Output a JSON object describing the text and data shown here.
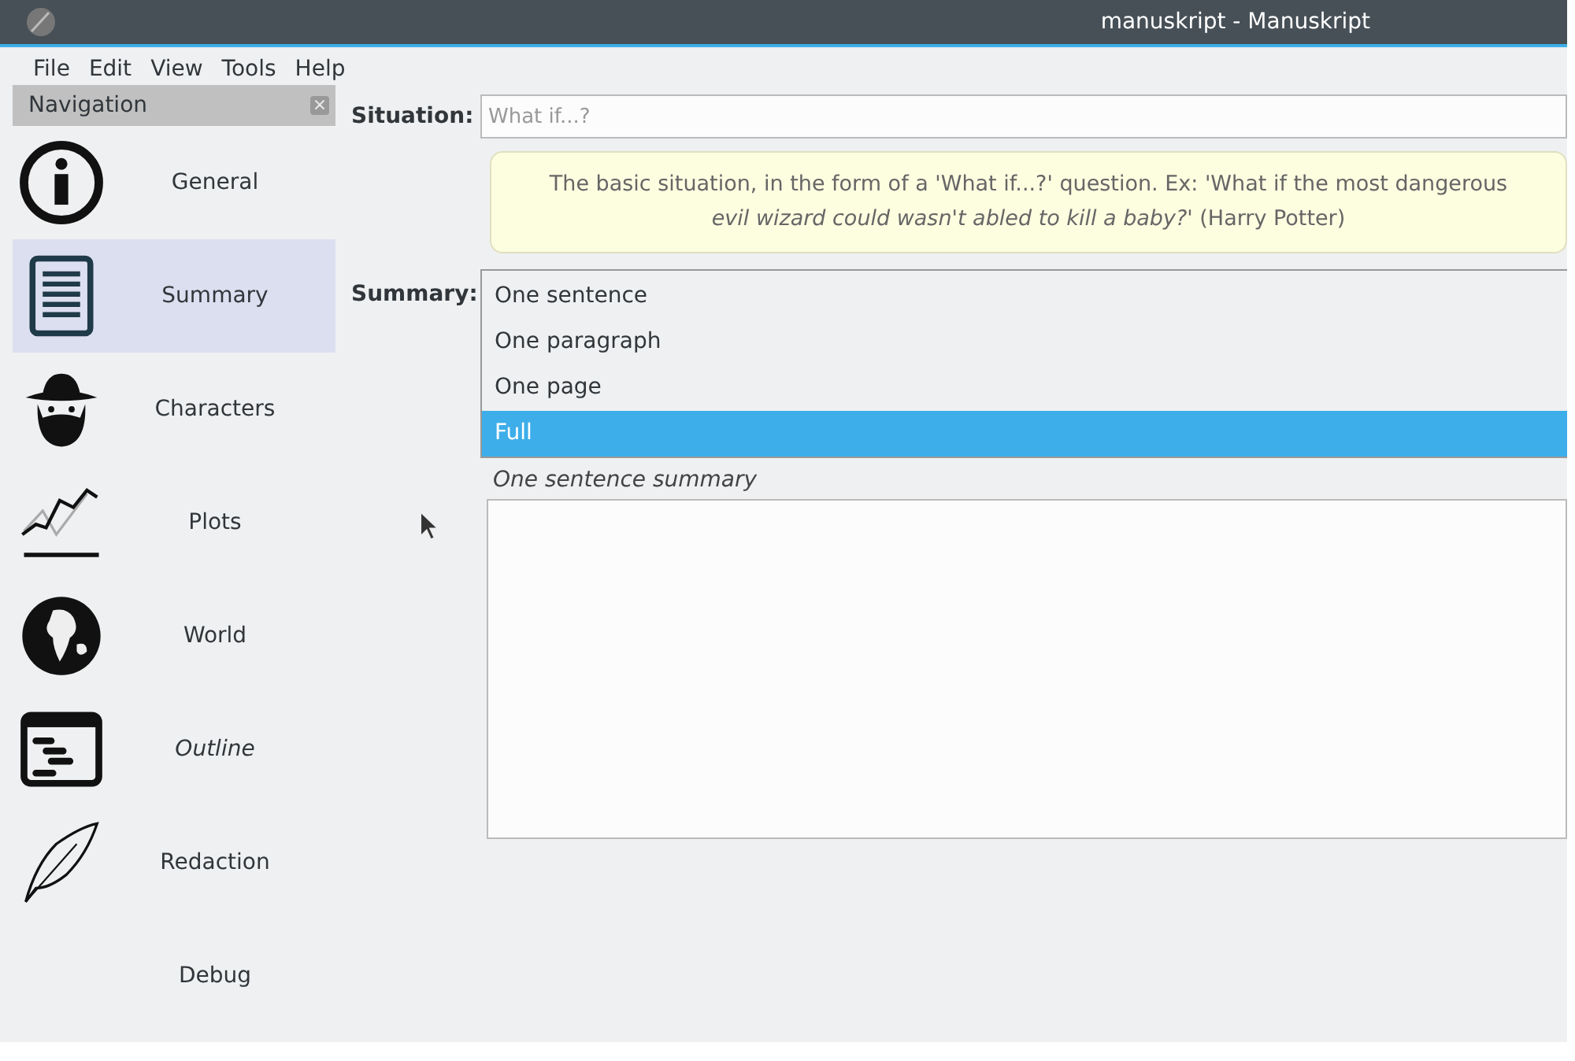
{
  "window": {
    "title": "manuskript - Manuskript"
  },
  "menu": [
    "File",
    "Edit",
    "View",
    "Tools",
    "Help"
  ],
  "navigation": {
    "title": "Navigation",
    "close": "×",
    "items": [
      {
        "label": "General",
        "kind": "info",
        "selected": false,
        "italic": false
      },
      {
        "label": "Summary",
        "kind": "document",
        "selected": true,
        "italic": false
      },
      {
        "label": "Characters",
        "kind": "character",
        "selected": false,
        "italic": false
      },
      {
        "label": "Plots",
        "kind": "plot",
        "selected": false,
        "italic": false
      },
      {
        "label": "World",
        "kind": "globe",
        "selected": false,
        "italic": false
      },
      {
        "label": "Outline",
        "kind": "outline",
        "selected": false,
        "italic": true
      },
      {
        "label": "Redaction",
        "kind": "quill",
        "selected": false,
        "italic": false
      },
      {
        "label": "Debug",
        "selected": false,
        "italic": false
      }
    ]
  },
  "situation": {
    "label": "Situation:",
    "placeholder": "What if...?"
  },
  "hint": {
    "text": "The basic situation, in the form of a 'What if...?' question. Ex: 'What if the most dangerous",
    "text_2": "*evil wizard could wasn't abled to kill a baby?'* (Harry Potter)"
  },
  "summary": {
    "label": "Summary:",
    "options": [
      {
        "label": "One sentence",
        "selected": false
      },
      {
        "label": "One paragraph",
        "selected": false
      },
      {
        "label": "One page",
        "selected": false
      },
      {
        "label": "Full",
        "selected": true
      }
    ],
    "caption": "One sentence summary"
  }
}
